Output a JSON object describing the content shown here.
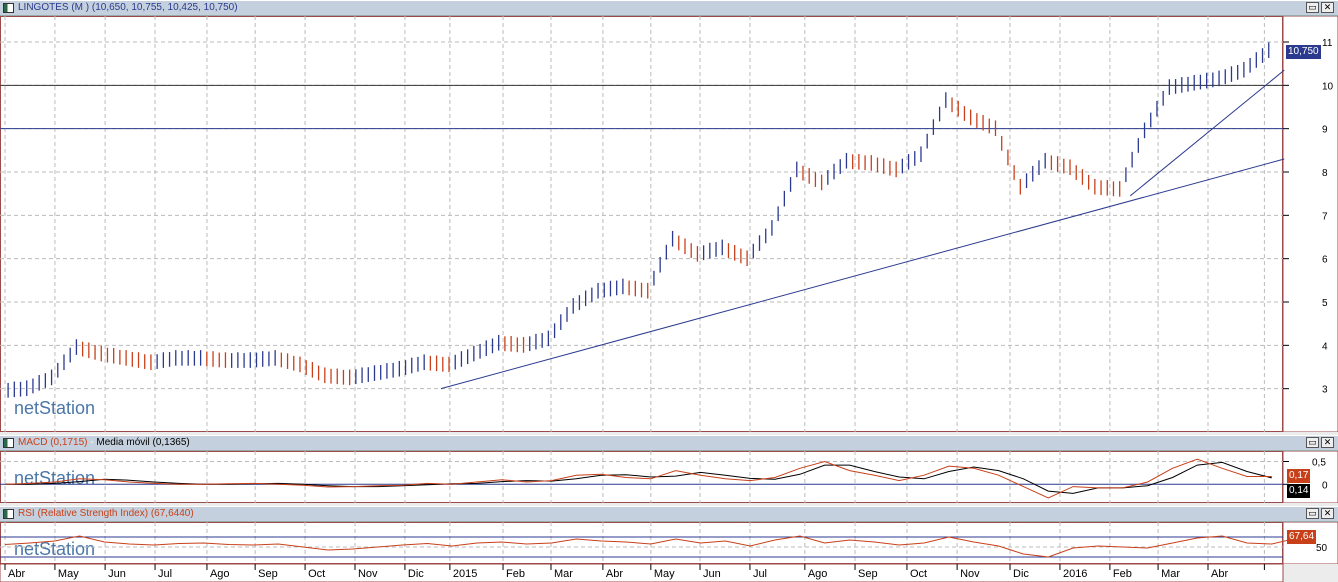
{
  "main": {
    "title": "LINGOTES (M ) (10,650, 10,755, 10,425, 10,750)",
    "last_label": "10,750",
    "y_ticks": [
      "3",
      "4",
      "5",
      "6",
      "7",
      "8",
      "9",
      "10",
      "11"
    ]
  },
  "macd": {
    "title_macd": "MACD (0,1715)",
    "title_sep": " - ",
    "title_ma": "Media móvil (0,1365)",
    "label_macd": "0,17",
    "label_signal": "0,14",
    "y_ticks": [
      "0,5",
      "0"
    ]
  },
  "rsi": {
    "title": "RSI (Relative Strength Index) (67,6440)",
    "label": "67,64",
    "y_ticks": [
      "50"
    ]
  },
  "watermark": "netStation",
  "colors": {
    "up": "#2b3a8f",
    "down": "#c8401a",
    "macd": "#c8401a",
    "signal": "#000000",
    "level": "#2b3a8f",
    "frame": "#9c4a4a"
  },
  "chart_data": [
    {
      "type": "line",
      "title": "LINGOTES (M )",
      "x_unit": "half-month index (Apr 2014 start)",
      "ylim": [
        2,
        11.6
      ],
      "horizontal_lines": [
        10,
        9
      ],
      "trendlines": [
        {
          "from": [
            17.55,
            3.0
          ],
          "to": [
            51.5,
            8.3
          ]
        },
        {
          "from": [
            45.3,
            7.45
          ],
          "to": [
            51.5,
            10.35
          ]
        }
      ],
      "values": [
        2.9,
        2.95,
        3.2,
        3.9,
        3.75,
        3.65,
        3.55,
        3.65,
        3.65,
        3.6,
        3.6,
        3.65,
        3.5,
        3.25,
        3.2,
        3.3,
        3.4,
        3.55,
        3.5,
        3.75,
        4.0,
        3.95,
        4.1,
        4.85,
        5.2,
        5.3,
        5.2,
        6.4,
        6.05,
        6.2,
        5.95,
        6.65,
        8.0,
        7.7,
        8.2,
        8.15,
        8.0,
        8.35,
        9.6,
        9.2,
        8.95,
        7.6,
        8.2,
        8.05,
        7.6,
        7.55,
        8.9,
        9.9,
        10.0,
        10.1,
        10.3,
        10.75
      ]
    },
    {
      "type": "line",
      "title": "MACD",
      "ylim": [
        -0.41,
        0.73
      ],
      "series": [
        {
          "name": "MACD",
          "values": [
            0,
            0.02,
            0.05,
            0.12,
            0.1,
            0.05,
            0.02,
            0,
            0,
            0.01,
            0.02,
            0,
            -0.02,
            -0.06,
            -0.05,
            -0.03,
            -0.02,
            0.02,
            0,
            0.05,
            0.1,
            0.05,
            0.08,
            0.2,
            0.22,
            0.15,
            0.12,
            0.3,
            0.2,
            0.12,
            0.08,
            0.15,
            0.35,
            0.5,
            0.3,
            0.2,
            0.08,
            0.2,
            0.4,
            0.35,
            0.2,
            -0.05,
            -0.3,
            -0.05,
            -0.08,
            -0.08,
            0.05,
            0.35,
            0.55,
            0.35,
            0.17,
            0.17
          ]
        },
        {
          "name": "Media móvil",
          "values": [
            0,
            0,
            0.02,
            0.06,
            0.11,
            0.09,
            0.05,
            0.02,
            0,
            0,
            0.01,
            0.02,
            0,
            -0.03,
            -0.05,
            -0.05,
            -0.03,
            -0.01,
            0.01,
            0.02,
            0.06,
            0.08,
            0.07,
            0.12,
            0.2,
            0.21,
            0.16,
            0.18,
            0.26,
            0.2,
            0.13,
            0.11,
            0.22,
            0.42,
            0.42,
            0.28,
            0.16,
            0.12,
            0.28,
            0.38,
            0.3,
            0.12,
            -0.15,
            -0.2,
            -0.08,
            -0.08,
            -0.03,
            0.15,
            0.42,
            0.48,
            0.28,
            0.14
          ]
        }
      ]
    },
    {
      "type": "line",
      "title": "RSI (Relative Strength Index)",
      "ylim": [
        16,
        100
      ],
      "levels": [
        70,
        30
      ],
      "values": [
        55,
        58,
        62,
        72,
        60,
        56,
        54,
        57,
        58,
        55,
        54,
        56,
        50,
        44,
        46,
        50,
        54,
        57,
        52,
        58,
        60,
        56,
        58,
        66,
        62,
        60,
        56,
        66,
        58,
        62,
        52,
        64,
        72,
        58,
        64,
        60,
        54,
        58,
        70,
        60,
        52,
        36,
        30,
        48,
        52,
        50,
        48,
        58,
        68,
        72,
        58,
        56,
        67.64
      ]
    }
  ],
  "x_axis": {
    "ticks": [
      {
        "label": "Abr",
        "i": 0
      },
      {
        "label": "May",
        "i": 2.01
      },
      {
        "label": "Jun",
        "i": 4.03
      },
      {
        "label": "Jul",
        "i": 6.04
      },
      {
        "label": "Ago",
        "i": 8.13
      },
      {
        "label": "Sep",
        "i": 10.07
      },
      {
        "label": "Oct",
        "i": 12.08
      },
      {
        "label": "Nov",
        "i": 14.09
      },
      {
        "label": "Dic",
        "i": 16.1
      },
      {
        "label": "2015",
        "i": 17.91
      },
      {
        "label": "Feb",
        "i": 20.05
      },
      {
        "label": "Mar",
        "i": 21.98
      },
      {
        "label": "Abr",
        "i": 24.07
      },
      {
        "label": "May",
        "i": 26.0
      },
      {
        "label": "Jun",
        "i": 27.98
      },
      {
        "label": "Jul",
        "i": 29.99
      },
      {
        "label": "Ago",
        "i": 32.2
      },
      {
        "label": "Sep",
        "i": 34.22
      },
      {
        "label": "Oct",
        "i": 36.31
      },
      {
        "label": "Nov",
        "i": 38.33
      },
      {
        "label": "Dic",
        "i": 40.46
      },
      {
        "label": "2016",
        "i": 42.47
      },
      {
        "label": "Feb",
        "i": 44.48
      },
      {
        "label": "Mar",
        "i": 46.42
      },
      {
        "label": "Abr",
        "i": 48.43
      },
      {
        "label": "",
        "i": 50.7
      }
    ]
  }
}
